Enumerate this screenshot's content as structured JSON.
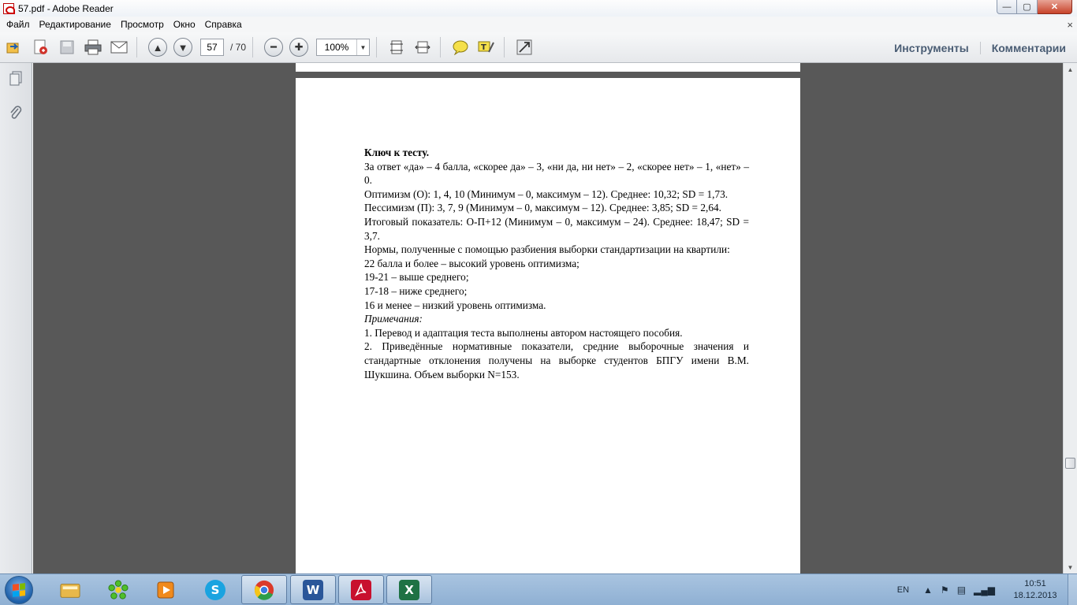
{
  "window": {
    "title": "57.pdf - Adobe Reader"
  },
  "window_controls": {
    "minimize": "—",
    "maximize": "▢",
    "close": "✕"
  },
  "menu": {
    "items": [
      "Файл",
      "Редактирование",
      "Просмотр",
      "Окно",
      "Справка"
    ],
    "close_glyph": "×"
  },
  "toolbar": {
    "page_current": "57",
    "page_total": "/ 70",
    "zoom": "100%",
    "tools_label": "Инструменты",
    "comments_label": "Комментарии"
  },
  "document": {
    "heading": "Ключ к тесту.",
    "paragraphs": [
      "За ответ «да» – 4 балла, «скорее да» – 3, «ни да, ни нет» – 2, «скорее нет» – 1, «нет» – 0.",
      "Оптимизм (О): 1, 4, 10 (Минимум  – 0, максимум  – 12). Среднее: 10,32; SD = 1,73.",
      "Пессимизм (П): 3, 7, 9 (Минимум  – 0, максимум  – 12). Среднее: 3,85; SD = 2,64.",
      "Итоговый показатель: О-П+12 (Минимум  – 0, максимум  – 24). Среднее: 18,47; SD = 3,7.",
      "Нормы, полученные с помощью разбиения выборки стандартизации на квартили:",
      "22 балла и более – высокий уровень оптимизма;",
      "19-21 – выше среднего;",
      "17-18 – ниже среднего;",
      "16 и менее – низкий уровень оптимизма."
    ],
    "notes_heading": "Примечания:",
    "notes": [
      "1. Перевод и адаптация теста выполнены автором настоящего пособия.",
      "2. Приведённые нормативные показатели, средние выборочные значения и стандартные отклонения получены на выборке студентов БПГУ имени В.М. Шукшина. Объем выборки N=153."
    ]
  },
  "taskbar": {
    "apps": [
      {
        "name": "explorer",
        "icon": "folder-icon",
        "color": "#e8b84a"
      },
      {
        "name": "icq",
        "icon": "flower-icon",
        "color": "#3fae2a"
      },
      {
        "name": "media-player",
        "icon": "play-icon",
        "color": "#f08a1c"
      },
      {
        "name": "skype",
        "icon": "skype-icon",
        "color": "#1aa3e0"
      },
      {
        "name": "chrome",
        "icon": "chrome-icon",
        "color": "#db3a2a"
      },
      {
        "name": "word",
        "icon": "word-icon",
        "color": "#2a5699"
      },
      {
        "name": "adobe-reader",
        "icon": "pdf-icon",
        "color": "#c8102e"
      },
      {
        "name": "excel",
        "icon": "excel-icon",
        "color": "#1f7244"
      }
    ],
    "lang": "EN",
    "time": "10:51",
    "date": "18.12.2013"
  }
}
